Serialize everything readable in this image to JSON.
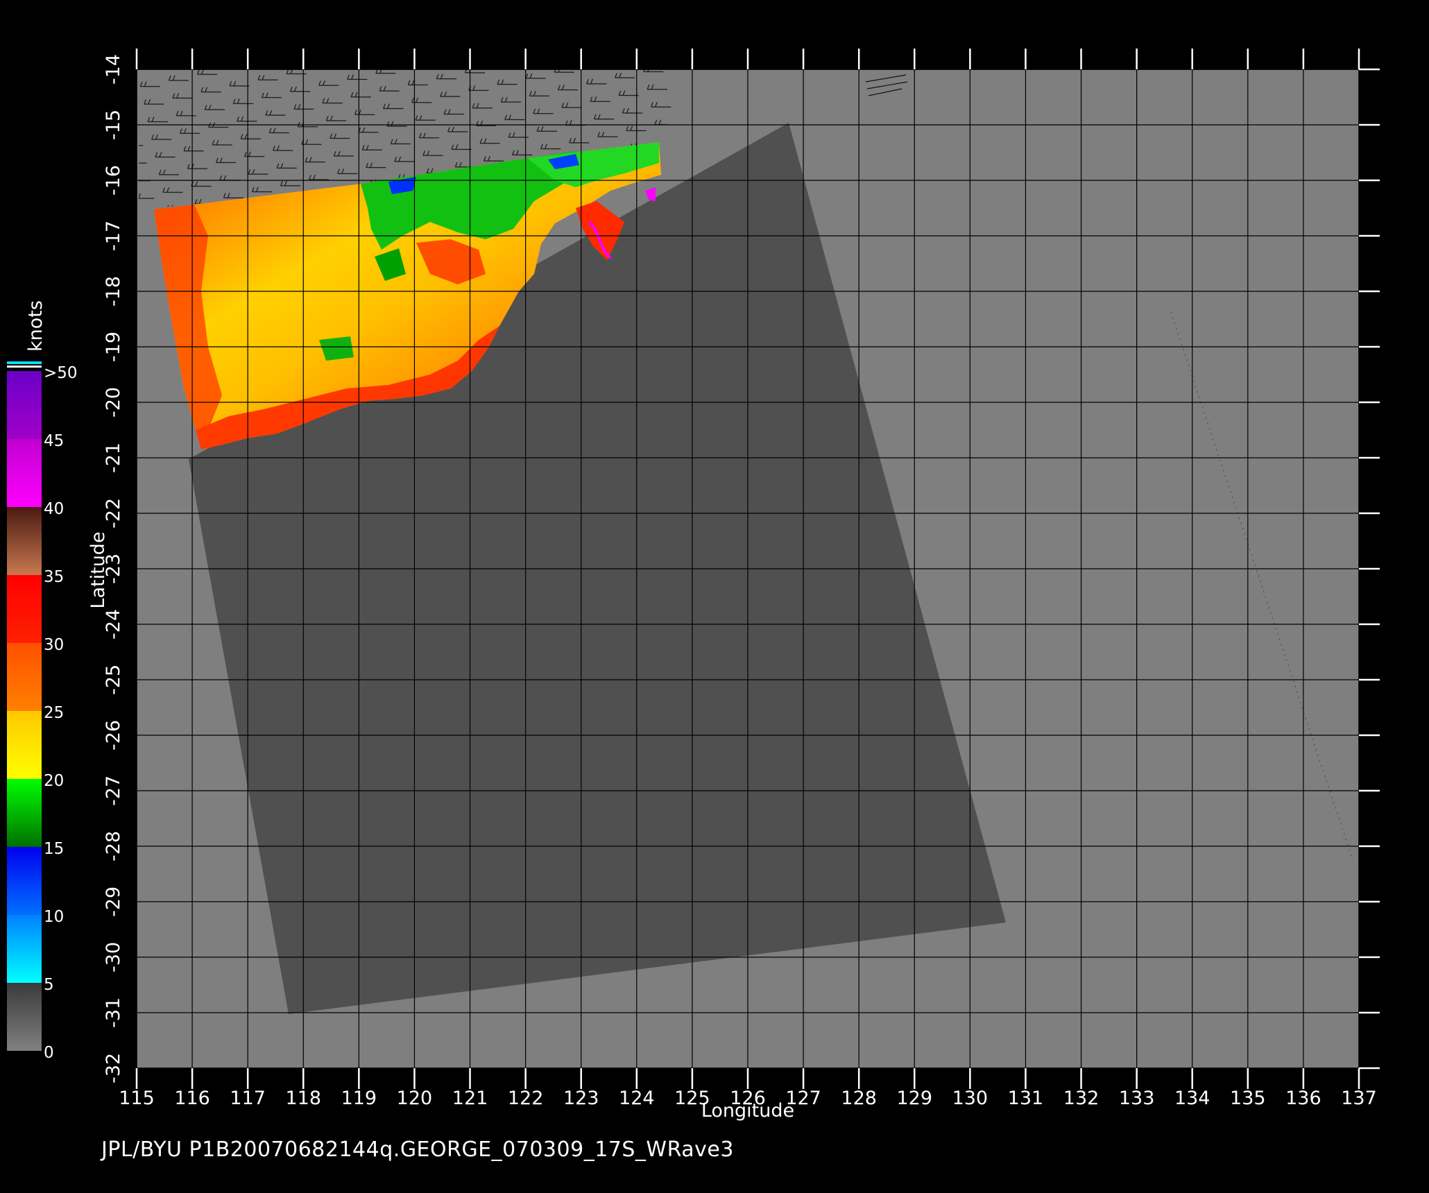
{
  "footer": {
    "caption": "JPL/BYU  P1B20070682144q.GEORGE_070309_17S_WRave3"
  },
  "axes": {
    "x_label": "Longitude",
    "y_label": "Latitude",
    "lon_ticks": [
      "115",
      "116",
      "117",
      "118",
      "119",
      "120",
      "121",
      "122",
      "123",
      "124",
      "125",
      "126",
      "127",
      "128",
      "129",
      "130",
      "131",
      "132",
      "133",
      "134",
      "135",
      "136",
      "137"
    ],
    "lat_ticks": [
      "-14",
      "-15",
      "-16",
      "-17",
      "-18",
      "-19",
      "-20",
      "-21",
      "-22",
      "-23",
      "-24",
      "-25",
      "-26",
      "-27",
      "-28",
      "-29",
      "-30",
      "-31",
      "-32"
    ],
    "lon_range": [
      115,
      137
    ],
    "lat_range": [
      -32,
      -14
    ],
    "grid": true
  },
  "colorbar": {
    "unit_label": "knots",
    "tick_labels": [
      "0",
      "5",
      "10",
      "15",
      "20",
      "25",
      "30",
      "35",
      "40",
      "45",
      ">50"
    ],
    "bands": [
      {
        "from": 0,
        "to": 5,
        "colors": [
          "#808080",
          "#3a3a3a"
        ]
      },
      {
        "from": 5,
        "to": 10,
        "colors": [
          "#00ffff",
          "#0080ff"
        ]
      },
      {
        "from": 10,
        "to": 15,
        "colors": [
          "#0070ff",
          "#0000ee"
        ]
      },
      {
        "from": 15,
        "to": 20,
        "colors": [
          "#007000",
          "#00ff00"
        ]
      },
      {
        "from": 20,
        "to": 25,
        "colors": [
          "#ffff00",
          "#ffc800"
        ]
      },
      {
        "from": 25,
        "to": 30,
        "colors": [
          "#ff8000",
          "#ff5000"
        ]
      },
      {
        "from": 30,
        "to": 35,
        "colors": [
          "#ff2000",
          "#ff0000"
        ]
      },
      {
        "from": 35,
        "to": 40,
        "colors": [
          "#c87850",
          "#4a1a10"
        ]
      },
      {
        "from": 40,
        "to": 45,
        "colors": [
          "#ff00ff",
          "#c000d0"
        ]
      },
      {
        "from": 45,
        "to": 50,
        "colors": [
          "#a000c8",
          "#6a00c8"
        ]
      }
    ]
  },
  "colors": {
    "background": "#000000",
    "land": "#7f7f7f",
    "swath_no_data": "#505050",
    "grid": "#000000",
    "axis": "#ffffff",
    "wind_barb": "#1a1a1a"
  }
}
